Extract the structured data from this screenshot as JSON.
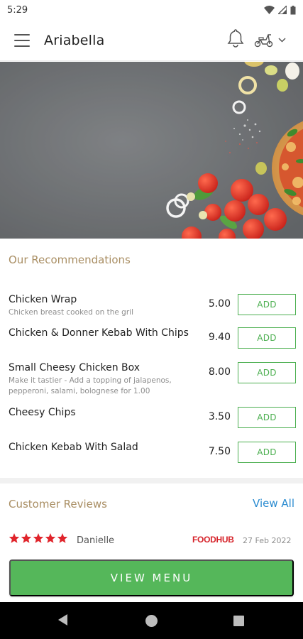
{
  "status_bar": {
    "time": "5:29",
    "icons": [
      "wifi-icon",
      "cell-signal-icon",
      "battery-icon"
    ]
  },
  "app_bar": {
    "title": "Ariabella",
    "icons": [
      "menu-icon",
      "bell-icon",
      "scooter-icon",
      "chevron-down-icon"
    ]
  },
  "recommendations": {
    "title": "Our Recommendations",
    "items": [
      {
        "name": "Chicken Wrap",
        "description": "Chicken breast cooked on the gril",
        "price": "5.00",
        "button": "ADD"
      },
      {
        "name": "Chicken & Donner Kebab With Chips",
        "description": "",
        "price": "9.40",
        "button": "ADD"
      },
      {
        "name": "Small Cheesy Chicken Box",
        "description": "Make it tastier - Add a topping of jalapenos, pepperoni, salami, bolognese for 1.00",
        "price": "8.00",
        "button": "ADD"
      },
      {
        "name": "Cheesy Chips",
        "description": "",
        "price": "3.50",
        "button": "ADD"
      },
      {
        "name": "Chicken Kebab With Salad",
        "description": "",
        "price": "7.50",
        "button": "ADD"
      }
    ]
  },
  "reviews": {
    "title": "Customer Reviews",
    "view_all": "View All",
    "items": [
      {
        "stars": 5,
        "name": "Danielle",
        "source": "FOODHUB",
        "date": "27 Feb 2022"
      }
    ]
  },
  "cta": {
    "label": "VIEW MENU"
  },
  "colors": {
    "accent_green": "#55b75a",
    "section_title": "#a98e63",
    "link_blue": "#2a8bd0",
    "star_red": "#e0242b",
    "foodhub_red": "#d6232a"
  }
}
